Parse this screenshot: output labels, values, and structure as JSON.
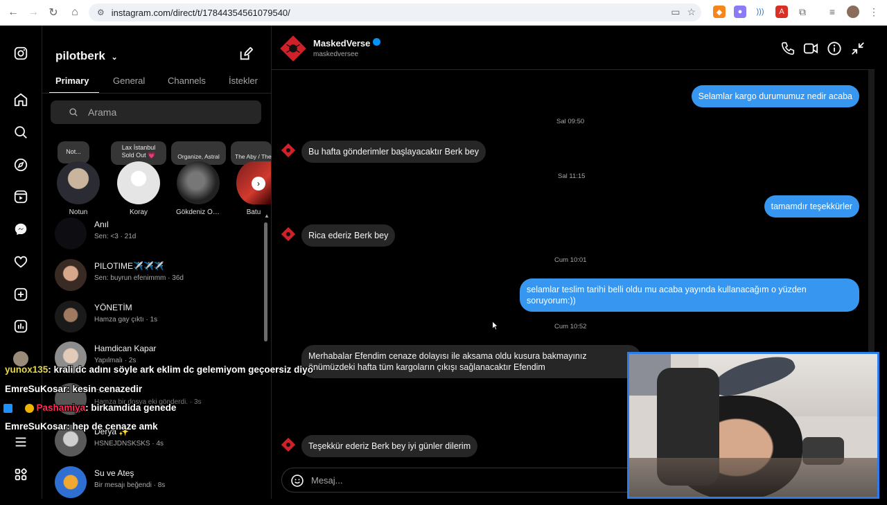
{
  "browser": {
    "url": "instagram.com/direct/t/17844354561079540/"
  },
  "sidebar": {
    "account_name": "pilotberk",
    "tabs": [
      {
        "label": "Primary"
      },
      {
        "label": "General"
      },
      {
        "label": "Channels"
      },
      {
        "label": "İstekler"
      }
    ],
    "search_placeholder": "Arama",
    "stories": [
      {
        "note": "Not...",
        "name": "Notun"
      },
      {
        "note": "Lax İstanbul\nSold Out 💗",
        "name": "Koray"
      },
      {
        "note": "Organize, Astral",
        "name": "Gökdeniz Özseç..."
      },
      {
        "note": "The Aby / The Weeknd",
        "name": "Batu"
      }
    ],
    "conversations": [
      {
        "name": "Anıl",
        "preview": "Sen: <3 · 21d"
      },
      {
        "name": "PILOTIME✈️✈️✈️",
        "preview": "Sen: buyrun efenimmm · 36d"
      },
      {
        "name": "YÖNETİM",
        "preview": "Hamza gay çıktı · 1s"
      },
      {
        "name": "Hamdican Kapar",
        "preview": "Yapılmalı · 2s"
      },
      {
        "name": "Hamza...",
        "preview": "Hamza bir dosya eki gönderdi. · 3s"
      },
      {
        "name": "Derya ✨",
        "preview": "HSNEJDNSKSKS · 4s"
      },
      {
        "name": "Su ve Ateş",
        "preview": "Bir mesajı beğendi · 8s"
      }
    ]
  },
  "chat": {
    "title": "MaskedVerse",
    "handle": "maskedversee",
    "messages": [
      {
        "dir": "out",
        "text": "Selamlar kargo durumumuz nedir acaba"
      },
      {
        "dir": "ts",
        "text": "Sal 09:50"
      },
      {
        "dir": "in",
        "text": "Bu hafta gönderimler başlayacaktır Berk bey"
      },
      {
        "dir": "ts",
        "text": "Sal 11:15"
      },
      {
        "dir": "out",
        "text": "tamamdır teşekkürler"
      },
      {
        "dir": "in",
        "text": "Rica ederiz Berk bey"
      },
      {
        "dir": "ts",
        "text": "Cum 10:01"
      },
      {
        "dir": "out",
        "text": "selamlar teslim tarihi belli oldu mu acaba yayında kullanacağım o yüzden soruyorum:))"
      },
      {
        "dir": "ts",
        "text": "Cum 10:52"
      },
      {
        "dir": "in",
        "text": "Merhabalar Efendim cenaze dolayısı ile aksama oldu kusura bakmayınız önümüzdeki hafta tüm kargoların çıkışı sağlanacaktır Efendim"
      },
      {
        "dir": "in",
        "text": "Teşekkür ederiz Berk bey iyi günler dilerim"
      }
    ],
    "input_placeholder": "Mesaj..."
  },
  "stream_chat": [
    {
      "user": "yunox135",
      "color": "#e8d94a",
      "text": ": krali dc adını söyle ark eklim dc gelemiyom geçoersiz diyo"
    },
    {
      "user": "EmreSuKosar",
      "color": "#ffffff",
      "text": ": kesin cenazedir"
    },
    {
      "user": "Pashamiya",
      "color": "#ff2d55",
      "text": ": birkamdida genede"
    },
    {
      "user": "EmreSuKosar",
      "color": "#ffffff",
      "text": ": hep de cenaze amk"
    }
  ],
  "colors": {
    "accent": "#3797f0",
    "bubble_in": "#262626",
    "cam_border": "#2d7de8"
  }
}
